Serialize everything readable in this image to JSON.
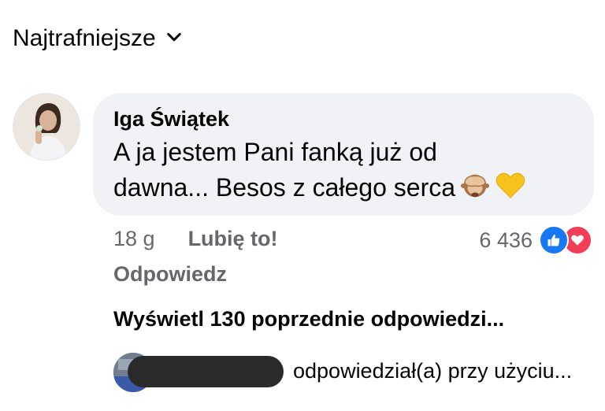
{
  "sort": {
    "label": "Najtrafniejsze",
    "icon": "chevron-down-icon"
  },
  "comment": {
    "author": "Iga Świątek",
    "text_line1": "A ja jestem Pani fanką już od",
    "text_line2": "dawna... Besos z całego serca",
    "emojis": [
      "see-no-evil-monkey",
      "yellow-heart"
    ],
    "time": "18 g",
    "like_label": "Lubię to!",
    "reply_label": "Odpowiedz",
    "reaction_count": "6 436",
    "reaction_icons": [
      "like-icon",
      "love-icon"
    ]
  },
  "replies": {
    "view_previous_label": "Wyświetl 130 poprzednie odpowiedzi...",
    "last_reply_text": "odpowiedział(a) przy użyciu..."
  },
  "colors": {
    "bubble": "#f0f2f5",
    "secondary_text": "#65676b",
    "like_blue": "#1877f2",
    "love_red": "#f33e58"
  }
}
